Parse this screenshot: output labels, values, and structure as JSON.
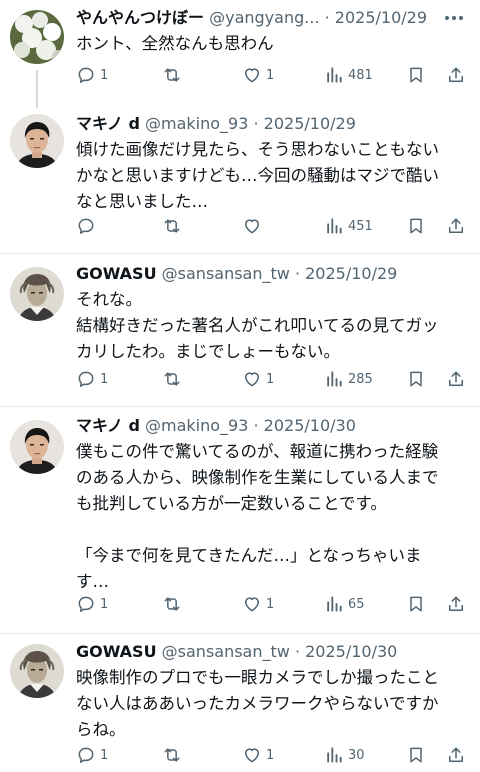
{
  "tweets": [
    {
      "name": "やんやんつけぼー",
      "handle": "@yangyang...",
      "date": "· 2025/10/29",
      "text": "ホント、全然なんも思わん",
      "replies": "1",
      "retweets": "",
      "likes": "1",
      "views": "481"
    },
    {
      "name": "マキノ d",
      "handle": "@makino_93",
      "date": "· 2025/10/29",
      "text": "傾けた画像だけ見たら、そう思わないこともない\nかなと思いますけども…今回の騒動はマジで酷い\nなと思いました…",
      "replies": "",
      "retweets": "",
      "likes": "",
      "views": "451"
    },
    {
      "name": "GOWASU",
      "handle": "@sansansan_tw",
      "date": "· 2025/10/29",
      "text": "それな。\n結構好きだった著名人がこれ叩いてるの見てガッ\nカリしたわ。まじでしょーもない。",
      "replies": "1",
      "retweets": "",
      "likes": "1",
      "views": "285"
    },
    {
      "name": "マキノ d",
      "handle": "@makino_93",
      "date": "· 2025/10/30",
      "text": "僕もこの件で驚いてるのが、報道に携わった経験\nのある人から、映像制作を生業にしている人まで\nも批判している方が一定数いることです。\n\n「今まで何を見てきたんだ…」となっちゃいま\nす…",
      "replies": "1",
      "retweets": "",
      "likes": "1",
      "views": "65"
    },
    {
      "name": "GOWASU",
      "handle": "@sansansan_tw",
      "date": "· 2025/10/30",
      "text": "映像制作のプロでも一眼カメラでしか撮ったこと\nない人はああいったカメラワークやらないですか\nらね。",
      "replies": "1",
      "retweets": "",
      "likes": "1",
      "views": "30"
    }
  ],
  "icons": {
    "reply": "reply-icon",
    "retweet": "retweet-icon",
    "like": "heart-icon",
    "views": "views-icon",
    "bookmark": "bookmark-icon",
    "share": "share-icon",
    "more": "more-icon"
  },
  "colors": {
    "text": "#0f1419",
    "muted": "#536471",
    "separator": "#e6e9ec",
    "thread_line": "#cfd9de"
  }
}
